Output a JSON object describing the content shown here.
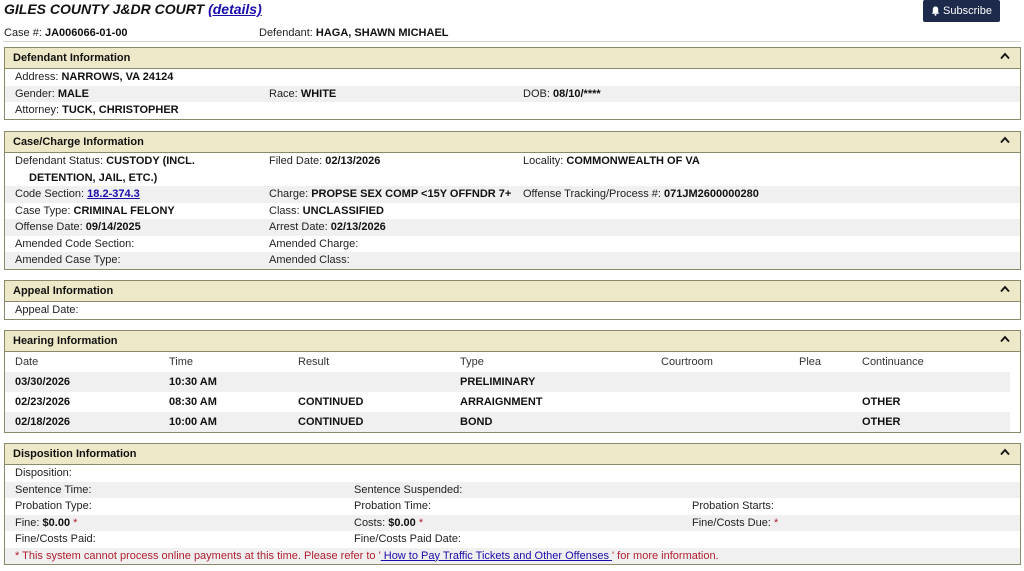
{
  "header": {
    "court_name": "GILES COUNTY J&DR COURT",
    "details_link": "(details)",
    "case_label": "Case #:",
    "case_number": "JA006066-01-00",
    "defendant_label": "Defendant:",
    "defendant_name": "HAGA, SHAWN MICHAEL",
    "subscribe_label": "Subscribe"
  },
  "defendant_info": {
    "title": "Defendant Information",
    "address_label": "Address:",
    "address": "NARROWS, VA 24124",
    "gender_label": "Gender:",
    "gender": "MALE",
    "race_label": "Race:",
    "race": "WHITE",
    "dob_label": "DOB:",
    "dob": "08/10/****",
    "attorney_label": "Attorney:",
    "attorney": "TUCK, CHRISTOPHER"
  },
  "case_charge": {
    "title": "Case/Charge Information",
    "status_label": "Defendant Status:",
    "status_line1": "CUSTODY (INCL.",
    "status_line2": "DETENTION, JAIL, ETC.)",
    "filed_label": "Filed Date:",
    "filed": "02/13/2026",
    "locality_label": "Locality:",
    "locality": "COMMONWEALTH OF VA",
    "code_label": "Code Section:",
    "code": "18.2-374.3",
    "charge_label": "Charge:",
    "charge": "PROPSE SEX COMP <15Y OFFNDR 7+",
    "otn_label": "Offense Tracking/Process #:",
    "otn": "071JM2600000280",
    "case_type_label": "Case Type:",
    "case_type": "CRIMINAL FELONY",
    "class_label": "Class:",
    "class": "UNCLASSIFIED",
    "offense_date_label": "Offense Date:",
    "offense_date": "09/14/2025",
    "arrest_label": "Arrest Date:",
    "arrest": "02/13/2026",
    "amended_code_label": "Amended Code Section:",
    "amended_charge_label": "Amended Charge:",
    "amended_case_type_label": "Amended Case Type:",
    "amended_class_label": "Amended Class:"
  },
  "appeal": {
    "title": "Appeal Information",
    "appeal_date_label": "Appeal Date:"
  },
  "hearing": {
    "title": "Hearing Information",
    "columns": [
      "Date",
      "Time",
      "Result",
      "Type",
      "Courtroom",
      "Plea",
      "Continuance"
    ],
    "rows": [
      [
        "03/30/2026",
        "10:30 AM",
        "",
        "PRELIMINARY",
        "",
        "",
        ""
      ],
      [
        "02/23/2026",
        "08:30 AM",
        "CONTINUED",
        "ARRAIGNMENT",
        "",
        "",
        "OTHER"
      ],
      [
        "02/18/2026",
        "10:00 AM",
        "CONTINUED",
        "BOND",
        "",
        "",
        "OTHER"
      ]
    ]
  },
  "disposition": {
    "title": "Disposition Information",
    "disposition_label": "Disposition:",
    "sentence_time_label": "Sentence Time:",
    "sentence_suspended_label": "Sentence Suspended:",
    "probation_type_label": "Probation Type:",
    "probation_time_label": "Probation Time:",
    "probation_starts_label": "Probation Starts:",
    "fine_label": "Fine:",
    "fine": "$0.00",
    "costs_label": "Costs:",
    "costs": "$0.00",
    "fine_costs_due_label": "Fine/Costs Due:",
    "asterisk": "*",
    "fine_costs_paid_label": "Fine/Costs Paid:",
    "fine_costs_paid_date_label": "Fine/Costs Paid Date:",
    "notice_prefix": "* This system cannot process online payments at this time. Please refer to '",
    "notice_link": " How to Pay Traffic Tickets and Other Offenses ",
    "notice_suffix": "' for more information."
  }
}
